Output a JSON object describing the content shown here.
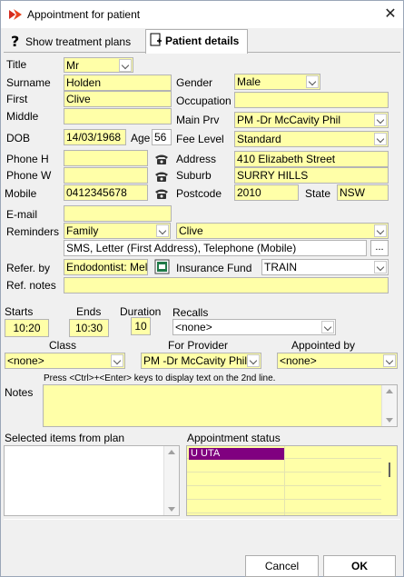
{
  "window": {
    "title": "Appointment for patient",
    "close_glyph": "✕",
    "app_icon": "app-logo-icon"
  },
  "tabs": [
    {
      "label": "Show treatment plans",
      "icon": "question-mark-icon",
      "active": false
    },
    {
      "label": "Patient details",
      "icon": "document-add-icon",
      "active": true
    }
  ],
  "patient": {
    "title_label": "Title",
    "title": "Mr",
    "surname_label": "Surname",
    "surname": "Holden",
    "first_label": "First",
    "first": "Clive",
    "middle_label": "Middle",
    "middle": "",
    "dob_label": "DOB",
    "dob": "14/03/1968",
    "age_label": "Age",
    "age": "56",
    "phone_h_label": "Phone H",
    "phone_h": "",
    "phone_w_label": "Phone W",
    "phone_w": "",
    "mobile_label": "Mobile",
    "mobile": "0412345678",
    "email_label": "E-mail",
    "email": "",
    "gender_label": "Gender",
    "gender": "Male",
    "occupation_label": "Occupation",
    "occupation": "",
    "main_prv_label": "Main Prv",
    "main_prv": "PM -Dr McCavity Phil",
    "fee_level_label": "Fee Level",
    "fee_level": "Standard",
    "address_label": "Address",
    "address": "410 Elizabeth Street",
    "suburb_label": "Suburb",
    "suburb": "SURRY HILLS",
    "postcode_label": "Postcode",
    "postcode": "2010",
    "state_label": "State",
    "state": "NSW",
    "reminders_label": "Reminders",
    "reminders_type": "Family",
    "reminders_person": "Clive",
    "reminders_methods": "SMS, Letter (First Address), Telephone (Mobile)",
    "reminders_more": "...",
    "refer_by_label": "Refer. by",
    "refer_by": "Endodontist: Mel",
    "insurance_label": "Insurance Fund",
    "insurance": "TRAIN",
    "ref_notes_label": "Ref. notes",
    "ref_notes": ""
  },
  "appointment": {
    "starts_label": "Starts",
    "starts": "10:20",
    "ends_label": "Ends",
    "ends": "10:30",
    "duration_label": "Duration",
    "duration": "10",
    "recalls_label": "Recalls",
    "recalls": "<none>",
    "class_label": "Class",
    "class": "<none>",
    "provider_label": "For Provider",
    "provider": "PM -Dr McCavity Phil",
    "appointed_by_label": "Appointed by",
    "appointed_by": "<none>",
    "hint": "Press <Ctrl>+<Enter> keys to display text on the 2nd line.",
    "notes_label": "Notes",
    "notes": "",
    "selected_items_label": "Selected items from plan",
    "status_label": "Appointment status",
    "status_entry": "U UTA",
    "status_color": "#800080"
  },
  "buttons": {
    "cancel": "Cancel",
    "ok": "OK"
  },
  "colors": {
    "field_bg": "#ffffa8",
    "window_bg": "#f0f0f0"
  }
}
